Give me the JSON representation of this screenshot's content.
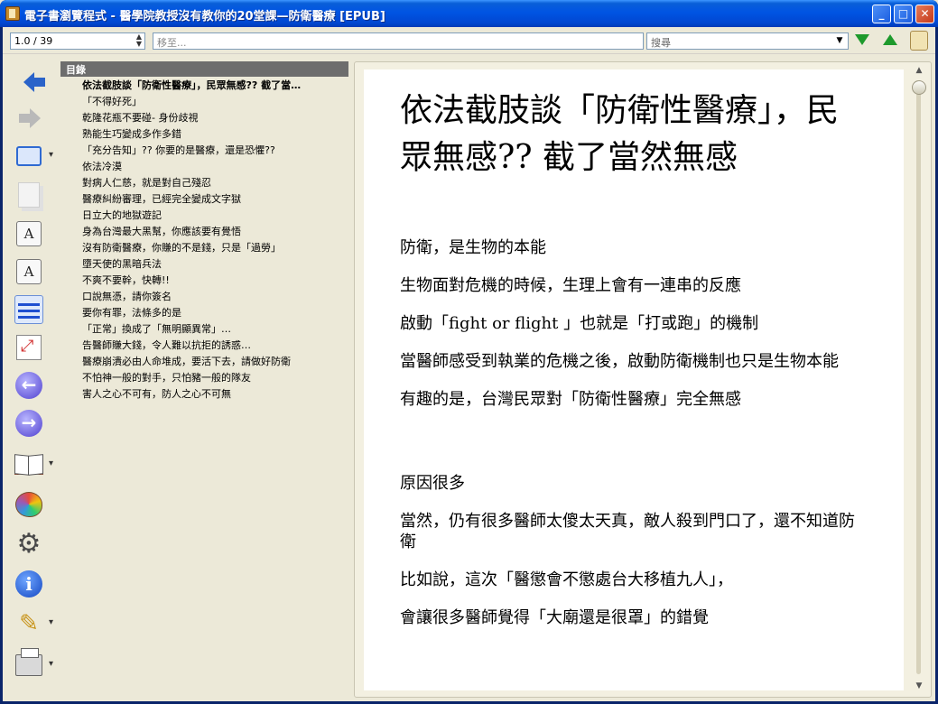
{
  "window": {
    "title": "電子書瀏覽程式 - 醫學院教授沒有教你的20堂課—防衛醫療 [EPUB]",
    "minimize": "_",
    "maximize": "□",
    "close": "✕"
  },
  "toolbar": {
    "page_value": "1.0 / 39",
    "goto_placeholder": "移至...",
    "search_placeholder": "搜尋",
    "icons": [
      "search-next-icon",
      "search-prev-icon",
      "scroll-icon"
    ]
  },
  "left_toolbar": {
    "icons": [
      "back-arrow-icon",
      "forward-arrow-icon",
      "book-view-icon",
      "pages-icon",
      "font-larger-icon",
      "font-smaller-icon",
      "line-spacing-icon",
      "fit-screen-icon",
      "prev-page-icon",
      "next-page-icon",
      "library-icon",
      "theme-icon",
      "settings-icon",
      "info-icon",
      "tools-icon",
      "print-icon"
    ],
    "font_larger": "A",
    "font_smaller": "A",
    "prev_glyph": "←",
    "next_glyph": "→",
    "info_glyph": "i",
    "gear_glyph": "⚙",
    "wand_glyph": "✎"
  },
  "toc": {
    "header": "目錄",
    "items": [
      "依法截肢談「防衛性醫療」，民眾無感?? 截了當…",
      "「不得好死」",
      "乾隆花瓶不要碰- 身份歧視",
      "熟能生巧變成多作多錯",
      "「充分告知」?? 你要的是醫療，還是恐懼??",
      "依法冷漠",
      "對病人仁慈，就是對自己殘忍",
      "醫療糾紛審理，已經完全變成文字獄",
      "日立大的地獄遊記",
      "身為台灣最大黑幫，你應該要有覺悟",
      "沒有防衛醫療，你賺的不是錢，只是「過勞」",
      "墮天使的黑暗兵法",
      "不爽不要幹，快轉!!",
      "口說無憑，請你簽名",
      "要你有罪，法條多的是",
      "「正常」換成了「無明顯異常」…",
      "告醫師賺大錢，令人難以抗拒的誘惑…",
      "醫療崩潰必由人命堆成，要活下去，請做好防衛",
      "不怕神一般的對手，只怕豬一般的隊友",
      "害人之心不可有，防人之心不可無"
    ]
  },
  "reader": {
    "title": "依法截肢談「防衛性醫療」，民眾無感?? 截了當然無感",
    "paragraphs": [
      "防衛，是生物的本能",
      "生物面對危機的時候，生理上會有一連串的反應",
      "啟動「fight or flight 」也就是「打或跑」的機制",
      "當醫師感受到執業的危機之後，啟動防衛機制也只是生物本能",
      "有趣的是，台灣民眾對「防衛性醫療」完全無感",
      "",
      "原因很多",
      "當然，仍有很多醫師太傻太天真，敵人殺到門口了，還不知道防衛",
      "比如說，這次「醫懲會不懲處台大移植九人」，",
      "會讓很多醫師覺得「大廟還是很罩」的錯覺"
    ]
  }
}
